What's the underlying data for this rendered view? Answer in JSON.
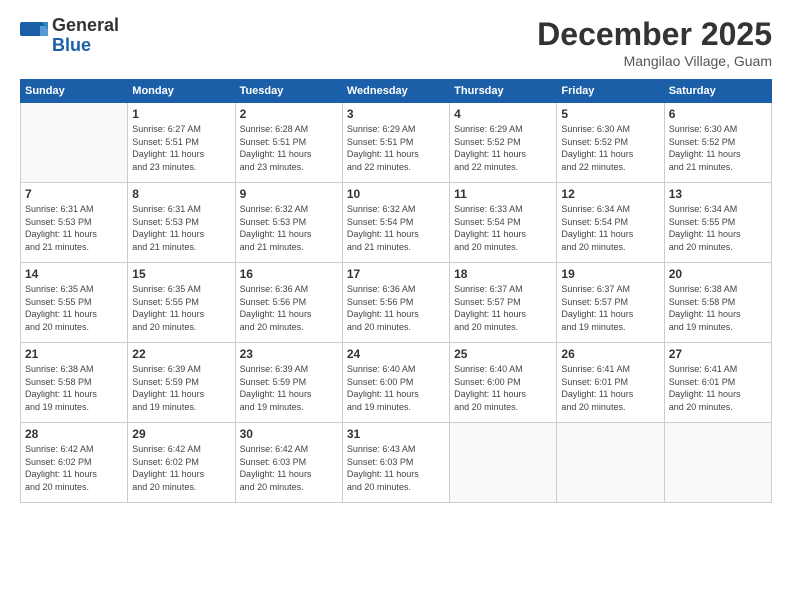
{
  "header": {
    "logo_line1": "General",
    "logo_line2": "Blue",
    "month_year": "December 2025",
    "location": "Mangilao Village, Guam"
  },
  "days_of_week": [
    "Sunday",
    "Monday",
    "Tuesday",
    "Wednesday",
    "Thursday",
    "Friday",
    "Saturday"
  ],
  "weeks": [
    [
      {
        "day": "",
        "info": ""
      },
      {
        "day": "1",
        "info": "Sunrise: 6:27 AM\nSunset: 5:51 PM\nDaylight: 11 hours\nand 23 minutes."
      },
      {
        "day": "2",
        "info": "Sunrise: 6:28 AM\nSunset: 5:51 PM\nDaylight: 11 hours\nand 23 minutes."
      },
      {
        "day": "3",
        "info": "Sunrise: 6:29 AM\nSunset: 5:51 PM\nDaylight: 11 hours\nand 22 minutes."
      },
      {
        "day": "4",
        "info": "Sunrise: 6:29 AM\nSunset: 5:52 PM\nDaylight: 11 hours\nand 22 minutes."
      },
      {
        "day": "5",
        "info": "Sunrise: 6:30 AM\nSunset: 5:52 PM\nDaylight: 11 hours\nand 22 minutes."
      },
      {
        "day": "6",
        "info": "Sunrise: 6:30 AM\nSunset: 5:52 PM\nDaylight: 11 hours\nand 21 minutes."
      }
    ],
    [
      {
        "day": "7",
        "info": "Sunrise: 6:31 AM\nSunset: 5:53 PM\nDaylight: 11 hours\nand 21 minutes."
      },
      {
        "day": "8",
        "info": "Sunrise: 6:31 AM\nSunset: 5:53 PM\nDaylight: 11 hours\nand 21 minutes."
      },
      {
        "day": "9",
        "info": "Sunrise: 6:32 AM\nSunset: 5:53 PM\nDaylight: 11 hours\nand 21 minutes."
      },
      {
        "day": "10",
        "info": "Sunrise: 6:32 AM\nSunset: 5:54 PM\nDaylight: 11 hours\nand 21 minutes."
      },
      {
        "day": "11",
        "info": "Sunrise: 6:33 AM\nSunset: 5:54 PM\nDaylight: 11 hours\nand 20 minutes."
      },
      {
        "day": "12",
        "info": "Sunrise: 6:34 AM\nSunset: 5:54 PM\nDaylight: 11 hours\nand 20 minutes."
      },
      {
        "day": "13",
        "info": "Sunrise: 6:34 AM\nSunset: 5:55 PM\nDaylight: 11 hours\nand 20 minutes."
      }
    ],
    [
      {
        "day": "14",
        "info": "Sunrise: 6:35 AM\nSunset: 5:55 PM\nDaylight: 11 hours\nand 20 minutes."
      },
      {
        "day": "15",
        "info": "Sunrise: 6:35 AM\nSunset: 5:55 PM\nDaylight: 11 hours\nand 20 minutes."
      },
      {
        "day": "16",
        "info": "Sunrise: 6:36 AM\nSunset: 5:56 PM\nDaylight: 11 hours\nand 20 minutes."
      },
      {
        "day": "17",
        "info": "Sunrise: 6:36 AM\nSunset: 5:56 PM\nDaylight: 11 hours\nand 20 minutes."
      },
      {
        "day": "18",
        "info": "Sunrise: 6:37 AM\nSunset: 5:57 PM\nDaylight: 11 hours\nand 20 minutes."
      },
      {
        "day": "19",
        "info": "Sunrise: 6:37 AM\nSunset: 5:57 PM\nDaylight: 11 hours\nand 19 minutes."
      },
      {
        "day": "20",
        "info": "Sunrise: 6:38 AM\nSunset: 5:58 PM\nDaylight: 11 hours\nand 19 minutes."
      }
    ],
    [
      {
        "day": "21",
        "info": "Sunrise: 6:38 AM\nSunset: 5:58 PM\nDaylight: 11 hours\nand 19 minutes."
      },
      {
        "day": "22",
        "info": "Sunrise: 6:39 AM\nSunset: 5:59 PM\nDaylight: 11 hours\nand 19 minutes."
      },
      {
        "day": "23",
        "info": "Sunrise: 6:39 AM\nSunset: 5:59 PM\nDaylight: 11 hours\nand 19 minutes."
      },
      {
        "day": "24",
        "info": "Sunrise: 6:40 AM\nSunset: 6:00 PM\nDaylight: 11 hours\nand 19 minutes."
      },
      {
        "day": "25",
        "info": "Sunrise: 6:40 AM\nSunset: 6:00 PM\nDaylight: 11 hours\nand 20 minutes."
      },
      {
        "day": "26",
        "info": "Sunrise: 6:41 AM\nSunset: 6:01 PM\nDaylight: 11 hours\nand 20 minutes."
      },
      {
        "day": "27",
        "info": "Sunrise: 6:41 AM\nSunset: 6:01 PM\nDaylight: 11 hours\nand 20 minutes."
      }
    ],
    [
      {
        "day": "28",
        "info": "Sunrise: 6:42 AM\nSunset: 6:02 PM\nDaylight: 11 hours\nand 20 minutes."
      },
      {
        "day": "29",
        "info": "Sunrise: 6:42 AM\nSunset: 6:02 PM\nDaylight: 11 hours\nand 20 minutes."
      },
      {
        "day": "30",
        "info": "Sunrise: 6:42 AM\nSunset: 6:03 PM\nDaylight: 11 hours\nand 20 minutes."
      },
      {
        "day": "31",
        "info": "Sunrise: 6:43 AM\nSunset: 6:03 PM\nDaylight: 11 hours\nand 20 minutes."
      },
      {
        "day": "",
        "info": ""
      },
      {
        "day": "",
        "info": ""
      },
      {
        "day": "",
        "info": ""
      }
    ]
  ]
}
